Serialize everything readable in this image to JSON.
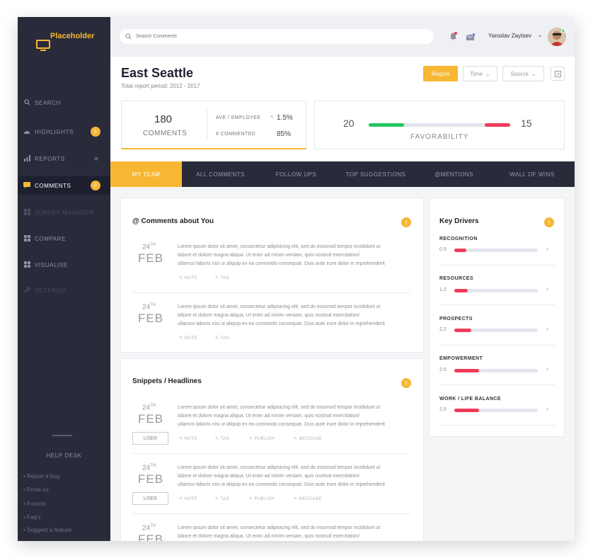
{
  "app": {
    "logo_text": "Placeholder"
  },
  "sidebar": {
    "items": [
      {
        "label": "SEARCH",
        "icon": "search-icon"
      },
      {
        "label": "HIGHLIGHTS",
        "icon": "dashboard-icon",
        "badge": "0"
      },
      {
        "label": "REPORTS",
        "icon": "bar-chart-icon",
        "plus": "+"
      },
      {
        "label": "COMMENTS",
        "icon": "comment-icon",
        "badge": "0"
      },
      {
        "label": "SURVEY MANAGER",
        "icon": "grid-icon"
      },
      {
        "label": "COMPARE",
        "icon": "grid-icon"
      },
      {
        "label": "VISUALISE",
        "icon": "grid-icon"
      },
      {
        "label": "SETTINGS",
        "icon": "wrench-icon"
      }
    ],
    "help_desk": "HELP DESK",
    "help_links": [
      "• Report a bug",
      "• Email us",
      "• Forums",
      "• Faq's",
      "• Suggest a feature"
    ]
  },
  "topbar": {
    "search_placeholder": "Search Comments",
    "user_name": "Yaroslav Zaytsev"
  },
  "header": {
    "title": "East Seattle",
    "subtitle": "Total report period: 2012 - 2017",
    "buttons": {
      "region": "Region",
      "time": "Time",
      "source": "Source"
    }
  },
  "stats": {
    "comments_count": "180",
    "comments_label": "COMMENTS",
    "ave_label": "AVE / EMPLOYEE",
    "ave_value": "1.5%",
    "commented_label": "# COMMENTED",
    "commented_value": "85%"
  },
  "favorability": {
    "left": "20",
    "right": "15",
    "label": "FAVORABILITY",
    "left_share": 0.25,
    "right_share": 0.18
  },
  "tabs": [
    "MY TEAM",
    "ALL COMMENTS",
    "FOLLOW UPS",
    "TOP SUGGESTIONS",
    "@MENTIONS",
    "WALL OF WINS"
  ],
  "lorem": {
    "l1": "Lorem ipsum dolor sit amet, consectetur adipisicing elit, sed do eiusmod tempor incididunt ut",
    "l2": "labore et dolore magna aliqua. Ut enim ad minim veniam, quis nostrud exercitation/",
    "l3": " ullamco laboris nisi ut aliquip ex ea commodo consequat. Duis aute irure dolor in reprehenderit"
  },
  "date": {
    "day": "24",
    "suffix": "TH",
    "month": "FEB"
  },
  "actions": {
    "note": "NOTE",
    "tag": "TAG",
    "publish": "PUBLISH",
    "message": "MESSAGE",
    "user": "USER"
  },
  "comments_panel": {
    "title": "@ Comments about You"
  },
  "snippets_panel": {
    "title": "Snippets / Headlines"
  },
  "key_drivers": {
    "title": "Key Drivers",
    "items": [
      {
        "label": "RECOGNITION",
        "value": "0.5",
        "level": 0.14
      },
      {
        "label": "RESOURCES",
        "value": "1.2",
        "level": 0.16
      },
      {
        "label": "PROSPECTS",
        "value": "2.2",
        "level": 0.2
      },
      {
        "label": "EMPOWERMENT",
        "value": "2.5",
        "level": 0.3
      },
      {
        "label": "WORK / LIFE BALANCE",
        "value": "2.5",
        "level": 0.3
      }
    ]
  }
}
